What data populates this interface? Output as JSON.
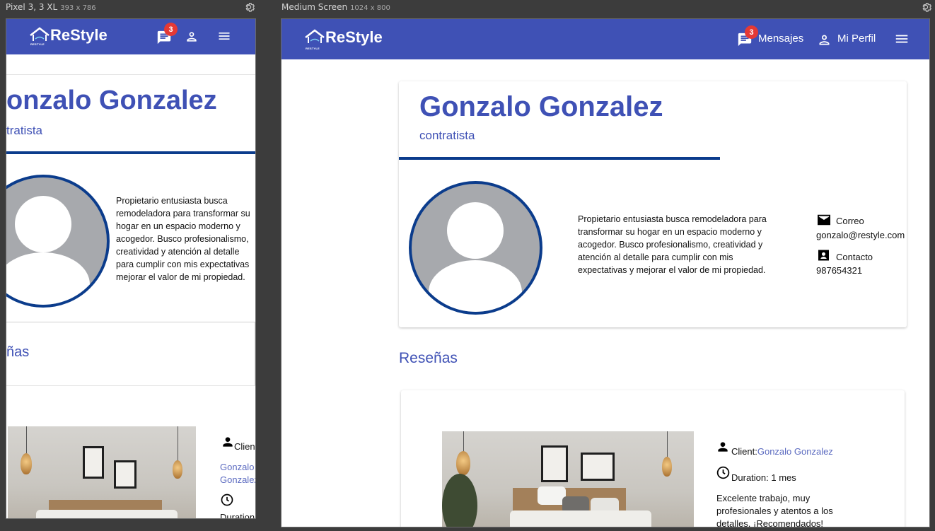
{
  "devices": {
    "mobile": {
      "name": "Pixel 3, 3 XL",
      "size": "393 x 786"
    },
    "medium": {
      "name": "Medium Screen",
      "size": "1024 x 800"
    }
  },
  "navbar": {
    "brand": "ReStyle",
    "brand_sub": "RESTYLE",
    "messages_badge": "3",
    "messages_label": "Mensajes",
    "profile_label": "Mi Perfil",
    "bg_color": "#3f51b5"
  },
  "profile": {
    "name": "Gonzalo Gonzalez",
    "role": "contratista",
    "description": "Propietario entusiasta busca remodeladora para transformar su hogar en un espacio moderno y acogedor. Busco profesionalismo, creatividad y atención al detalle para cumplir con mis expectativas y mejorar el valor de mi propiedad.",
    "email_label": "Correo",
    "email": "gonzalo@restyle.com",
    "contact_label": "Contacto",
    "phone": "987654321"
  },
  "reviews": {
    "title": "Reseñas",
    "mobile_title_fragment": "ñas",
    "items": [
      {
        "client_label": "Client:",
        "client_label_mobile": "Clien",
        "client_name": "Gonzalo Gonzalez",
        "client_name_line1": "Gonzalo",
        "client_name_line2": "Gonzalez",
        "duration_label": "Duration: 1 mes",
        "duration_label_mobile": "Duration:",
        "comment": "Excelente trabajo, muy profesionales y atentos a los detalles. ¡Recomendados!"
      }
    ]
  },
  "mobile_fragments": {
    "name": "onzalo Gonzalez",
    "role": "tratista",
    "desc_lines": [
      "Propietario entusiasta busca",
      "remodeladora para transformar su",
      "hogar en un espacio moderno y",
      "acogedor. Busco profesionalismo,",
      "creatividad y atención al detalle",
      "para cumplir con mis expectativas",
      "mejorar el valor de mi propiedad."
    ]
  },
  "icons": [
    "settings-icon",
    "chat-icon",
    "person-icon",
    "menu-icon",
    "email-icon",
    "contact-icon",
    "clock-icon",
    "home-logo-icon"
  ]
}
